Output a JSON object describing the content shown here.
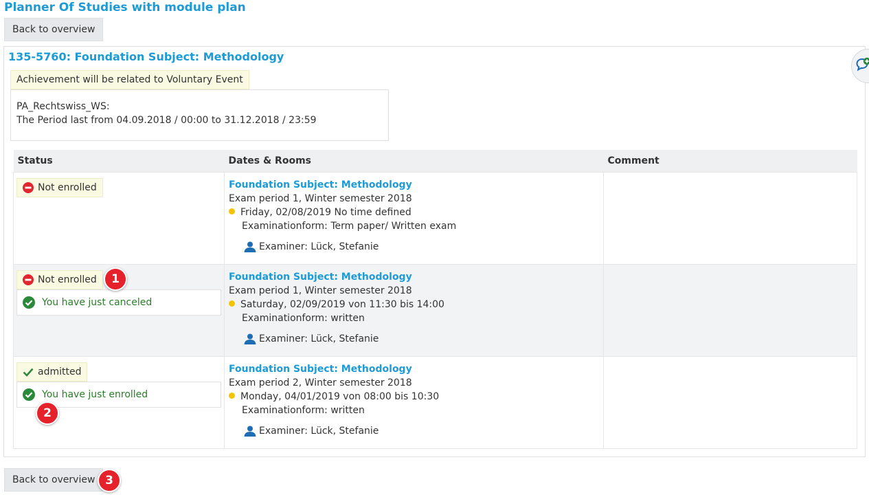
{
  "page_title": "Planner Of Studies with module plan",
  "back_button_label": "Back to overview",
  "module": {
    "title": "135-5760: Foundation Subject: Methodology",
    "notice": "Achievement will be related to Voluntary Event",
    "period_name": "PA_Rechtswiss_WS:",
    "period_text": "The Period last from 04.09.2018 / 00:00 to 31.12.2018 / 23:59"
  },
  "table": {
    "headers": {
      "status": "Status",
      "dates": "Dates & Rooms",
      "comment": "Comment"
    },
    "rows": [
      {
        "status": "Not enrolled",
        "message": "",
        "title": "Foundation Subject: Methodology",
        "period": "Exam period 1, Winter semester 2018",
        "date": "Friday, 02/08/2019 No time defined",
        "form": "Examinationform: Term paper/ Written exam",
        "examiner": "Examiner: Lück, Stefanie",
        "comment": ""
      },
      {
        "status": "Not enrolled",
        "message": "You have just canceled",
        "title": "Foundation Subject: Methodology",
        "period": "Exam period 1, Winter semester 2018",
        "date": "Saturday, 02/09/2019 von 11:30 bis 14:00",
        "form": "Examinationform: written",
        "examiner": "Examiner: Lück, Stefanie",
        "comment": ""
      },
      {
        "status": "admitted",
        "message": "You have just enrolled",
        "title": "Foundation Subject: Methodology",
        "period": "Exam period 2, Winter semester 2018",
        "date": "Monday, 04/01/2019 von 08:00 bis 10:30",
        "form": "Examinationform: written",
        "examiner": "Examiner: Lück, Stefanie",
        "comment": ""
      }
    ]
  },
  "badges": [
    "1",
    "2",
    "3"
  ],
  "icons": {
    "not_enrolled": "no-entry-icon",
    "admitted": "checkmark-icon",
    "success": "check-circle-icon",
    "examiner": "person-icon",
    "date_marker": "yellow-dot-icon",
    "feedback": "chat-plus-icon"
  },
  "colors": {
    "link": "#1d9bd7",
    "error": "#e0262f",
    "success": "#2a8a3a",
    "notice_bg": "#fafae3",
    "badge": "#e5212b",
    "dot": "#f5c400",
    "person": "#1f6db3"
  }
}
